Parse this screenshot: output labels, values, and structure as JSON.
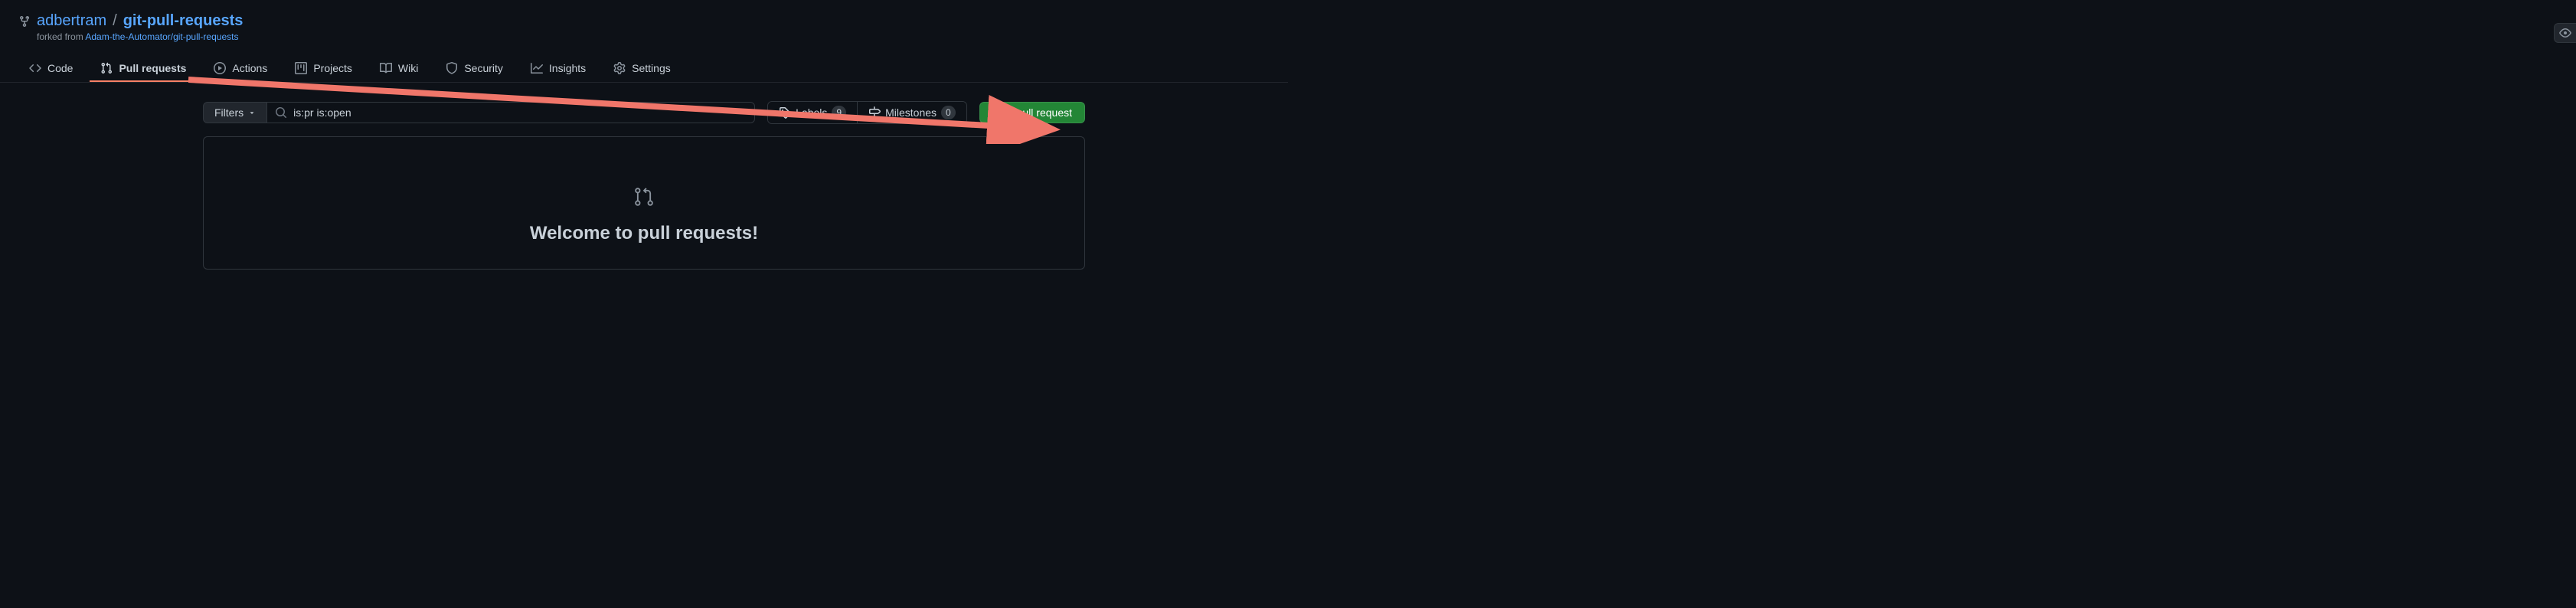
{
  "repo": {
    "owner": "adbertram",
    "name": "git-pull-requests",
    "forked_from_prefix": "forked from ",
    "forked_from": "Adam-the-Automator/git-pull-requests"
  },
  "tabs": {
    "code": "Code",
    "pull_requests": "Pull requests",
    "actions": "Actions",
    "projects": "Projects",
    "wiki": "Wiki",
    "security": "Security",
    "insights": "Insights",
    "settings": "Settings"
  },
  "filter": {
    "button_label": "Filters",
    "search_value": "is:pr is:open"
  },
  "buttons": {
    "labels": "Labels",
    "labels_count": "9",
    "milestones": "Milestones",
    "milestones_count": "0",
    "new_pr": "New pull request"
  },
  "welcome": {
    "title": "Welcome to pull requests!"
  }
}
